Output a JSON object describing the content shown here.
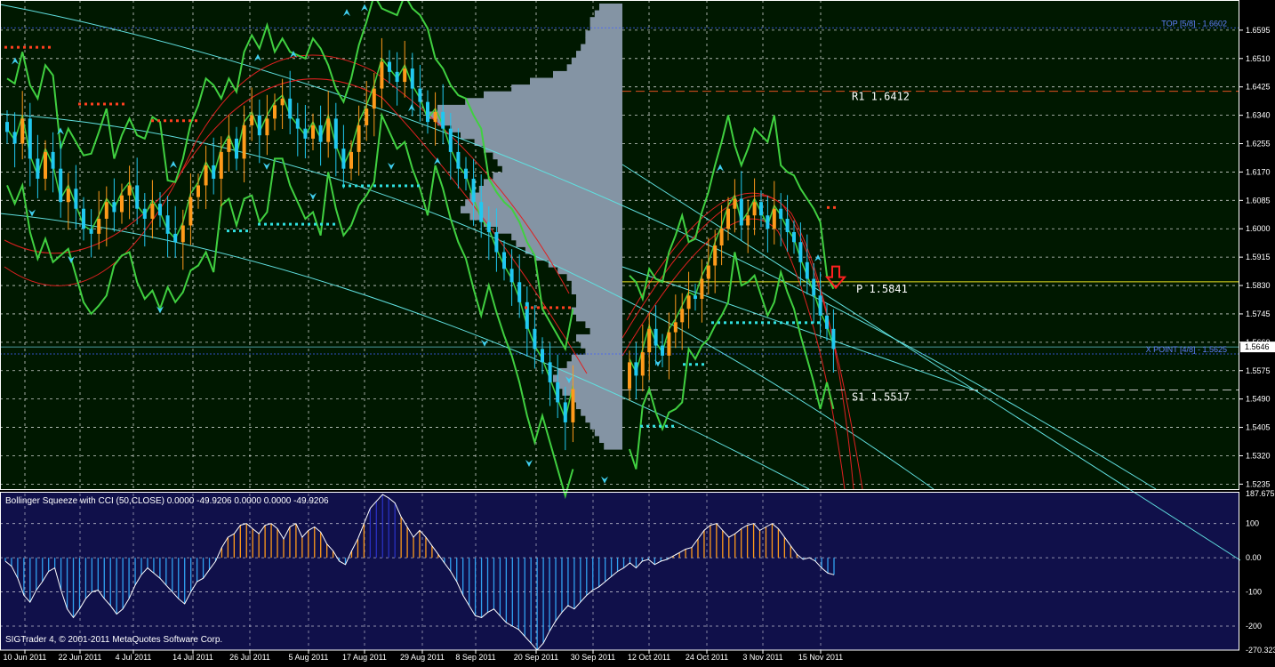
{
  "colors": {
    "main_bg": "#001800",
    "sub_bg": "#10104a",
    "axis": "#ffffff",
    "grid": "#ffffff",
    "bull": "#ff9a1a",
    "bear": "#20c8f0",
    "band": "#40d040",
    "channel_red": "#e02020",
    "trend_cyan": "#60e0e0",
    "profile": "#8494a4",
    "pivot_p": "#e8e020",
    "r1_line": "#e05020",
    "s1_line": "#c0c0c0",
    "dots_red": "#ff4020",
    "dots_cyan": "#30e0e0",
    "osc_line": "#ffffff",
    "osc_pos": "#ff9a1a",
    "osc_pos_strong": "#2830c0",
    "osc_neg": "#30a0f0",
    "murrey": "#4060ff"
  },
  "chart_data": [
    {
      "type": "candlestick",
      "symbol_hint": "",
      "y_ticks": [
        "1.6595",
        "1.6510",
        "1.6425",
        "1.6340",
        "1.6255",
        "1.6170",
        "1.6085",
        "1.6000",
        "1.5915",
        "1.5830",
        "1.5745",
        "1.5660",
        "1.5575",
        "1.5490",
        "1.5405",
        "1.5320",
        "1.5235"
      ],
      "ylim": [
        1.522,
        1.668
      ],
      "current_price_label": "1.5646",
      "x_labels": [
        "10 Jun 2011",
        "22 Jun 2011",
        "4 Jul 2011",
        "14 Jul 2011",
        "26 Jul 2011",
        "5 Aug 2011",
        "17 Aug 2011",
        "29 Aug 2011",
        "8 Sep 2011",
        "20 Sep 2011",
        "30 Sep 2011",
        "12 Oct 2011",
        "24 Oct 2011",
        "3 Nov 2011",
        "15 Nov 2011"
      ],
      "levels": [
        {
          "label": "TOP  [5/8] - 1.6602",
          "value": 1.6602,
          "style": "murrey"
        },
        {
          "label": "R1  1.6412",
          "value": 1.6412,
          "style": "r1"
        },
        {
          "label": "P  1.5841",
          "value": 1.5841,
          "style": "p"
        },
        {
          "label": "X POINT  [4/8] - 1.5625",
          "value": 1.5625,
          "style": "murrey"
        },
        {
          "label": "S1  1.5517",
          "value": 1.5517,
          "style": "s1"
        }
      ],
      "current_price": 1.5646,
      "closes": [
        1.629,
        1.6255,
        1.633,
        1.621,
        1.615,
        1.623,
        1.618,
        1.608,
        1.612,
        1.606,
        1.6,
        1.5985,
        1.603,
        1.608,
        1.605,
        1.61,
        1.613,
        1.606,
        1.603,
        1.6075,
        1.604,
        1.5985,
        1.596,
        1.601,
        1.6095,
        1.613,
        1.619,
        1.615,
        1.623,
        1.627,
        1.621,
        1.631,
        1.634,
        1.628,
        1.633,
        1.637,
        1.639,
        1.633,
        1.63,
        1.627,
        1.631,
        1.626,
        1.633,
        1.624,
        1.618,
        1.623,
        1.631,
        1.636,
        1.642,
        1.65,
        1.647,
        1.644,
        1.648,
        1.642,
        1.638,
        1.632,
        1.635,
        1.63,
        1.623,
        1.618,
        1.615,
        1.608,
        1.602,
        1.599,
        1.593,
        1.588,
        1.584,
        1.578,
        1.57,
        1.564,
        1.56,
        1.554,
        1.548,
        1.542,
        1.552,
        1.56,
        1.556,
        1.563,
        1.57,
        1.565,
        1.562,
        1.569,
        1.572,
        1.576,
        1.58,
        1.579,
        1.585,
        1.589,
        1.595,
        1.6,
        1.606,
        1.609,
        1.601,
        1.604,
        1.608,
        1.604,
        1.6,
        1.606,
        1.603,
        1.599,
        1.596,
        1.59,
        1.585,
        1.58,
        1.574,
        1.57,
        1.564
      ],
      "series": [
        {
          "name": "Bollinger Squeeze with CCI (50,CLOSE)",
          "values": [
            0.0,
            -49.9206,
            0.0,
            0.0,
            -49.9206
          ]
        }
      ]
    },
    {
      "type": "bar",
      "title": "Bollinger Squeeze with CCI (50,CLOSE) 0.0000 -49.9206 0.0000 0.0000 -49.9206",
      "y_ticks": [
        "187.675",
        "100",
        "0.00",
        "-100",
        "-200",
        "-270.323"
      ],
      "ylim": [
        -270.323,
        187.675
      ],
      "values": [
        -10,
        -25,
        -60,
        -110,
        -130,
        -95,
        -70,
        -40,
        -30,
        -95,
        -150,
        -175,
        -150,
        -120,
        -100,
        -95,
        -120,
        -140,
        -165,
        -150,
        -120,
        -80,
        -50,
        -30,
        -45,
        -60,
        -80,
        -100,
        -120,
        -135,
        -100,
        -70,
        -60,
        -35,
        -10,
        30,
        60,
        70,
        95,
        100,
        85,
        70,
        95,
        100,
        85,
        55,
        90,
        100,
        60,
        80,
        90,
        75,
        40,
        20,
        -10,
        -20,
        20,
        55,
        100,
        145,
        165,
        185,
        175,
        160,
        120,
        90,
        60,
        80,
        60,
        35,
        10,
        -15,
        -40,
        -70,
        -110,
        -140,
        -170,
        -175,
        -160,
        -150,
        -170,
        -190,
        -200,
        -210,
        -230,
        -250,
        -270,
        -250,
        -215,
        -185,
        -160,
        -140,
        -150,
        -130,
        -110,
        -95,
        -85,
        -70,
        -55,
        -40,
        -30,
        -15,
        -30,
        -10,
        -5,
        -20,
        -10,
        -5,
        5,
        15,
        25,
        30,
        55,
        80,
        95,
        100,
        80,
        60,
        70,
        85,
        95,
        100,
        80,
        90,
        100,
        85,
        60,
        35,
        10,
        -5,
        0,
        -10,
        -30,
        -45,
        -50
      ],
      "current_values": [
        "0.0000",
        "-49.9206",
        "0.0000",
        "0.0000",
        "-49.9206"
      ]
    }
  ],
  "footer": {
    "copyright": "SIGTrader 4, © 2001-2011 MetaQuotes Software Corp."
  }
}
